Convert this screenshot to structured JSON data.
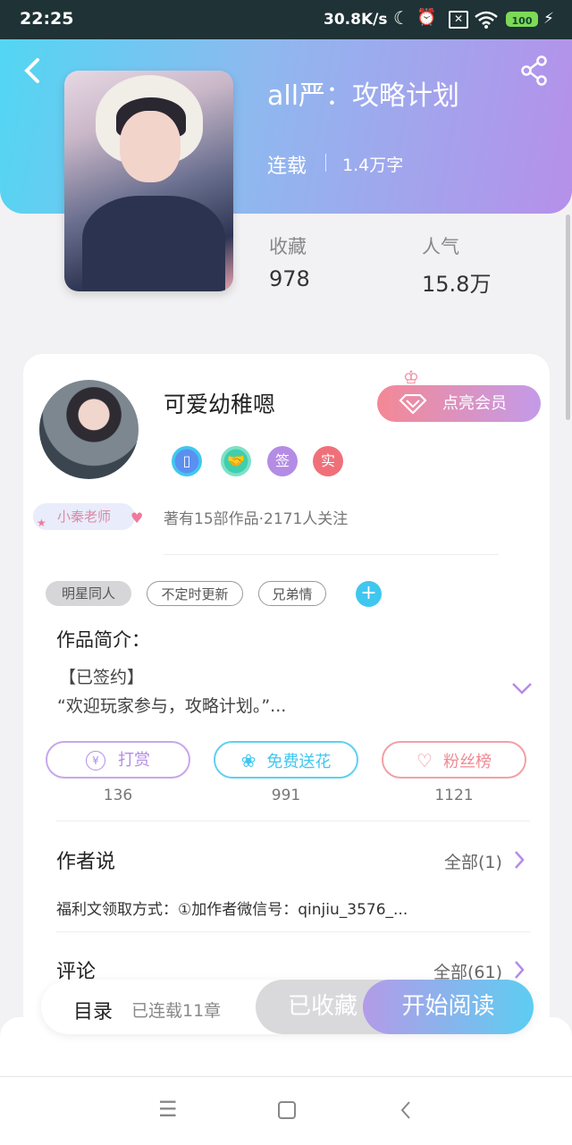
{
  "status_bar": {
    "time": "22:25",
    "net_speed": "30.8K/s",
    "battery": "100"
  },
  "book": {
    "title": "all严：攻略计划",
    "status": "连载",
    "word_count": "1.4万字"
  },
  "stats": [
    {
      "label": "收藏",
      "value": "978"
    },
    {
      "label": "人气",
      "value": "15.8万"
    }
  ],
  "author": {
    "name": "可爱幼稚嗯",
    "teacher_badge": "小秦老师",
    "works_info": "著有15部作品·2171人关注",
    "vip_button": "点亮会员",
    "badges": [
      "签",
      "实"
    ]
  },
  "tags": [
    "明星同人",
    "不定时更新",
    "兄弟情"
  ],
  "intro": {
    "heading": "作品简介：",
    "line1": "【已签约】",
    "line2": "“欢迎玩家参与，攻略计划。”..."
  },
  "actions": [
    {
      "label": "打赏",
      "count": "136",
      "color": "#b48ce6"
    },
    {
      "label": "免费送花",
      "count": "991",
      "color": "#3fc7ef"
    },
    {
      "label": "粉丝榜",
      "count": "1121",
      "color": "#ef8a93"
    }
  ],
  "author_say": {
    "heading": "作者说",
    "more": "全部(1)",
    "text": "福利文领取方式：①加作者微信号：qinjiu_3576_..."
  },
  "comments": {
    "heading": "评论",
    "more": "全部(61)"
  },
  "bottom_bar": {
    "toc": "目录",
    "chapters": "已连载11章",
    "collected": "已收藏",
    "read": "开始阅读"
  }
}
